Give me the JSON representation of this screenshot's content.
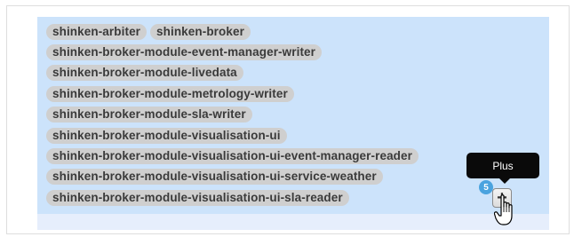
{
  "tags": [
    [
      "shinken-arbiter",
      "shinken-broker"
    ],
    [
      "shinken-broker-module-event-manager-writer"
    ],
    [
      "shinken-broker-module-livedata"
    ],
    [
      "shinken-broker-module-metrology-writer"
    ],
    [
      "shinken-broker-module-sla-writer"
    ],
    [
      "shinken-broker-module-visualisation-ui"
    ],
    [
      "shinken-broker-module-visualisation-ui-event-manager-reader"
    ],
    [
      "shinken-broker-module-visualisation-ui-service-weather"
    ],
    [
      "shinken-broker-module-visualisation-ui-sla-reader"
    ]
  ],
  "add_button": {
    "symbol": "+",
    "badge_count": "5",
    "tooltip": "Plus"
  },
  "colors": {
    "panel": "#cce3fb",
    "tag": "#cfcfcf",
    "badge": "#4aa3df",
    "tooltip": "#0a0a0a"
  }
}
